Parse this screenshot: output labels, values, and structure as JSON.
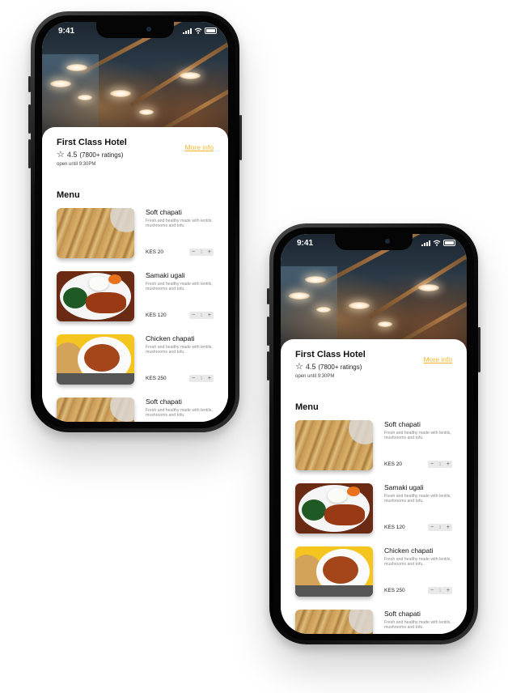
{
  "status_bar": {
    "time": "9:41"
  },
  "hotel": {
    "name": "First Class Hotel",
    "more_info": "More info",
    "rating": "4.5",
    "ratings_count": "(7800+ ratings)",
    "open_until": "open until 9:30PM"
  },
  "menu": {
    "title": "Menu",
    "items": [
      {
        "name": "Soft chapati",
        "description": "Fresh and healthy made with lentils, mushrooms and tofu.",
        "price": "KES 20",
        "qty": "1",
        "image": "chapati"
      },
      {
        "name": "Samaki ugali",
        "description": "Fresh and healthy made with lentils, mushrooms and tofu.",
        "price": "KES 120",
        "qty": "1",
        "image": "ugali"
      },
      {
        "name": "Chicken chapati",
        "description": "Fresh and healthy made with lentils, mushrooms and tofu.",
        "price": "KES 250",
        "qty": "1",
        "image": "chicken"
      },
      {
        "name": "Soft chapati",
        "description": "Fresh and healthy made with lentils, mushrooms and tofu.",
        "image": "chapati"
      }
    ]
  },
  "icons": {
    "star": "star-outline-icon",
    "minus": "minus-icon",
    "plus": "plus-icon"
  },
  "colors": {
    "accent": "#f0b52a",
    "frame": "#111111"
  }
}
